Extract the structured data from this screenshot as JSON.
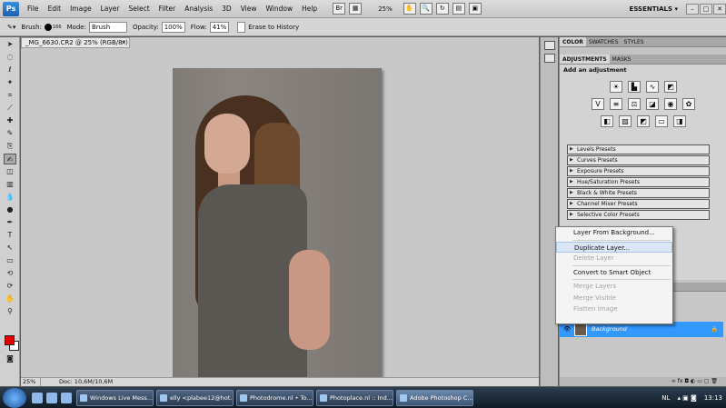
{
  "menubar": {
    "logo": "Ps",
    "items": [
      "File",
      "Edit",
      "Image",
      "Layer",
      "Select",
      "Filter",
      "Analysis",
      "3D",
      "View",
      "Window",
      "Help"
    ],
    "zoom": "25%",
    "workspace": "ESSENTIALS ▾",
    "win_buttons": [
      "–",
      "□",
      "✕"
    ]
  },
  "options": {
    "brush_label": "Brush:",
    "brush_size": "166",
    "mode_label": "Mode:",
    "mode_value": "Brush",
    "opacity_label": "Opacity:",
    "opacity_value": "100%",
    "flow_label": "Flow:",
    "flow_value": "41%",
    "erase_label": "Erase to History"
  },
  "document": {
    "tab_title": "_MG_6630.CR2 @ 25% (RGB/8*)",
    "status_zoom": "25%",
    "status_doc": "Doc: 10,6M/10,6M"
  },
  "panels": {
    "top_tabs": [
      "COLOR",
      "SWATCHES",
      "STYLES"
    ],
    "adj_tabs": [
      "ADJUSTMENTS",
      "MASKS"
    ],
    "adj_title": "Add an adjustment",
    "presets": [
      "Levels Presets",
      "Curves Presets",
      "Exposure Presets",
      "Hue/Saturation Presets",
      "Black & White Presets",
      "Channel Mixer Presets",
      "Selective Color Presets"
    ],
    "layer_name": "Background"
  },
  "context_menu": {
    "items": [
      {
        "label": "Layer From Background...",
        "state": "enabled"
      },
      {
        "label": "Duplicate Layer...",
        "state": "highlighted"
      },
      {
        "label": "Delete Layer",
        "state": "disabled"
      },
      {
        "label": "Convert to Smart Object",
        "state": "enabled"
      },
      {
        "label": "Merge Layers",
        "state": "disabled"
      },
      {
        "label": "Merge Visible",
        "state": "disabled"
      },
      {
        "label": "Flatten Image",
        "state": "disabled"
      }
    ]
  },
  "taskbar": {
    "tasks": [
      "Windows Live Mess...",
      "elly <plabee12@hot...",
      "Photodrome.nl • To...",
      "Photoplace.nl :: Ind...",
      "Adobe Photoshop C..."
    ],
    "lang": "NL",
    "time": "13:13"
  }
}
